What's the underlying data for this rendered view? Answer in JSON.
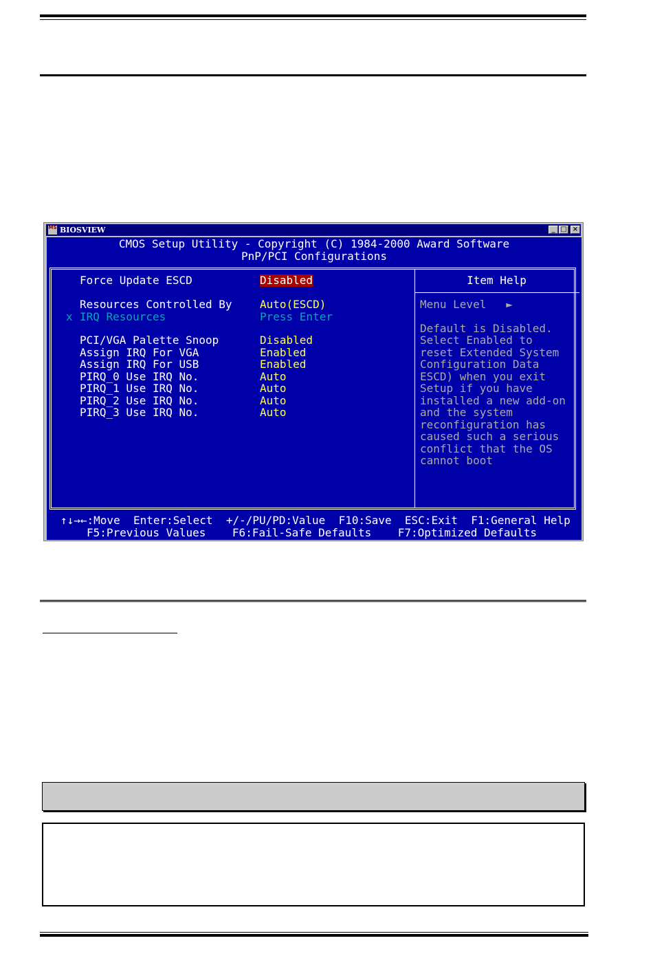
{
  "window": {
    "title": "BIOSVIEW",
    "logo": "MS",
    "buttons": {
      "minimize": "_",
      "maximize": "□",
      "close": "×"
    }
  },
  "screen": {
    "header_line1": "CMOS Setup Utility - Copyright (C) 1984-2000 Award Software",
    "header_line2": "PnP/PCI Configurations",
    "settings": [
      {
        "label": "Force Update ESCD",
        "value": "Disabled"
      },
      {
        "label": "Resources Controlled By",
        "value": "Auto(ESCD)"
      },
      {
        "label": "IRQ Resources",
        "value": "Press Enter",
        "marker": "x"
      },
      {
        "label": "PCI/VGA Palette Snoop",
        "value": "Disabled"
      },
      {
        "label": "Assign IRQ For VGA",
        "value": "Enabled"
      },
      {
        "label": "Assign IRQ For USB",
        "value": "Enabled"
      },
      {
        "label": "PIRQ_0 Use IRQ No.",
        "value": "Auto"
      },
      {
        "label": "PIRQ_1 Use IRQ No.",
        "value": "Auto"
      },
      {
        "label": "PIRQ_2 Use IRQ No.",
        "value": "Auto"
      },
      {
        "label": "PIRQ_3 Use IRQ No.",
        "value": "Auto"
      }
    ],
    "help": {
      "title": "Item Help",
      "menu_level": "Menu Level   ►",
      "lines": [
        "Default is Disabled.",
        "Select Enabled to",
        "reset Extended System",
        "Configuration Data",
        "ESCD) when you exit",
        "Setup if you have",
        "installed a new add-on",
        "and the system",
        "reconfiguration has",
        "caused such a serious",
        "conflict that the OS",
        "cannot boot"
      ]
    },
    "footer_line1": "↑↓→←:Move  Enter:Select  +/-/PU/PD:Value  F10:Save  ESC:Exit  F1:General Help",
    "footer_line2": "F5:Previous Values    F6:Fail-Safe Defaults    F7:Optimized Defaults"
  },
  "colors": {
    "bios_background": "#0000a8",
    "value_text": "#ffff55",
    "disabled_text": "#00aaaa",
    "highlight": "#aa0000",
    "help_text": "#aaaaaa"
  }
}
